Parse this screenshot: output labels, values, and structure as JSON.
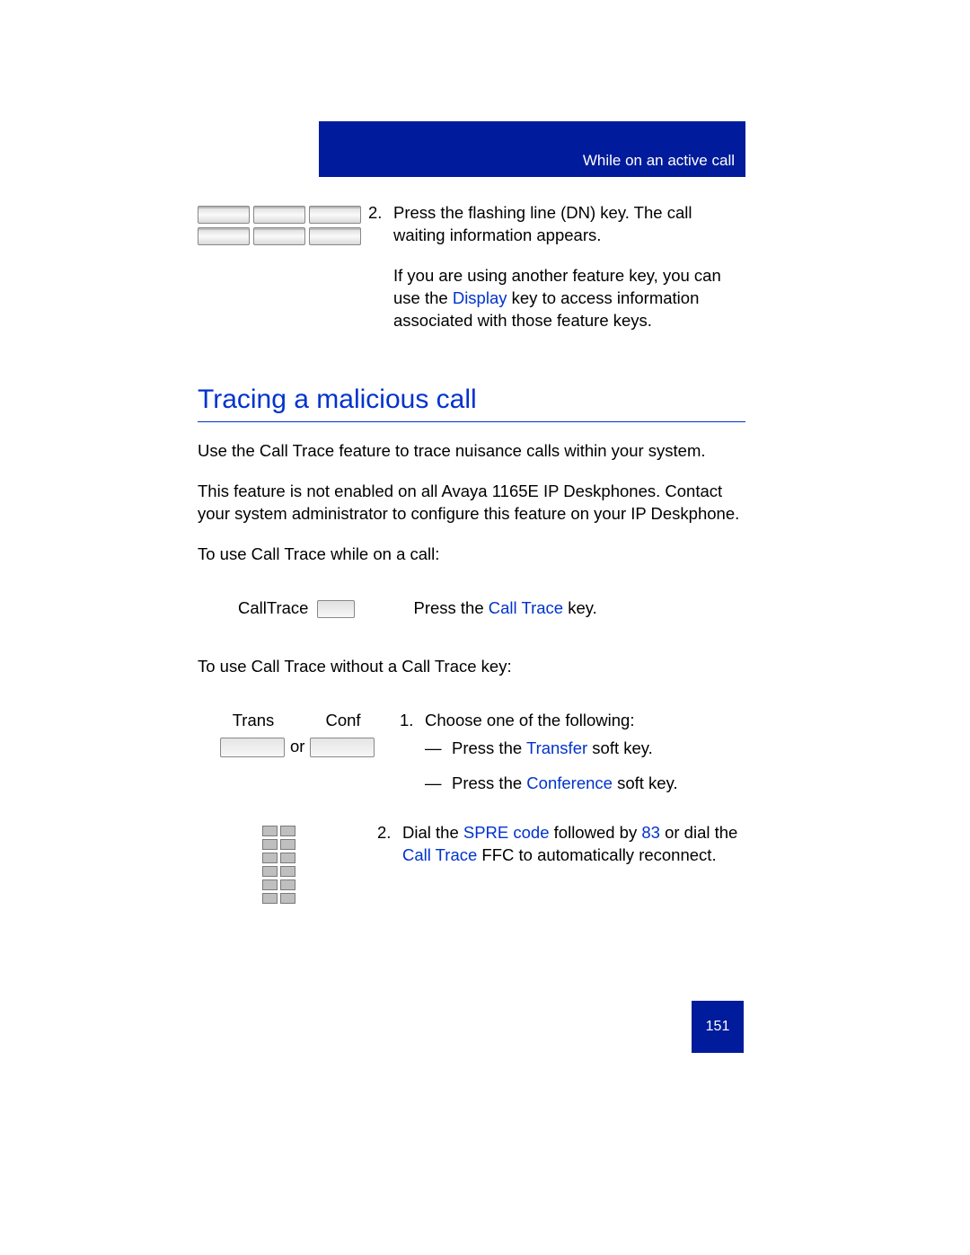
{
  "header": {
    "title": "While on an active call"
  },
  "step2a": {
    "num": "2.",
    "line": "Press the flashing line (DN) key. The call waiting information appears."
  },
  "step2b": {
    "pre": "If you are using another feature key, you can use the ",
    "link": "Display",
    "post": "  key to access information associated with those feature keys."
  },
  "section_heading": "Tracing a malicious call",
  "body1": "Use the Call Trace feature to trace nuisance calls within your system.",
  "body2": "This feature is not enabled on all Avaya 1165E IP Deskphones. Contact your system administrator to configure this feature on your IP Deskphone.",
  "body3": "To use Call Trace while on a call:",
  "calltrace_label": "CallTrace",
  "ct_instr_pre": "Press the ",
  "ct_instr_link": "Call Trace",
  "ct_instr_post": "  key.",
  "body4": "To use Call Trace without a Call Trace key:",
  "tk": {
    "trans": "Trans",
    "conf": "Conf",
    "or": "or"
  },
  "choose": {
    "num": "1.",
    "lead": "Choose one of the following:",
    "dash": "—",
    "opt1_pre": "Press the ",
    "opt1_link": "Transfer",
    "opt1_post": "  soft key.",
    "opt2_pre": "Press the ",
    "opt2_link": "Conference",
    "opt2_post": "  soft key."
  },
  "dial": {
    "num": "2.",
    "p1": "Dial the ",
    "l1": "SPRE code",
    "p2": "  followed by ",
    "l2": "83",
    "p3": " or dial the ",
    "l3": "Call Trace",
    "p4": "  FFC to automatically reconnect."
  },
  "page_number": "151"
}
